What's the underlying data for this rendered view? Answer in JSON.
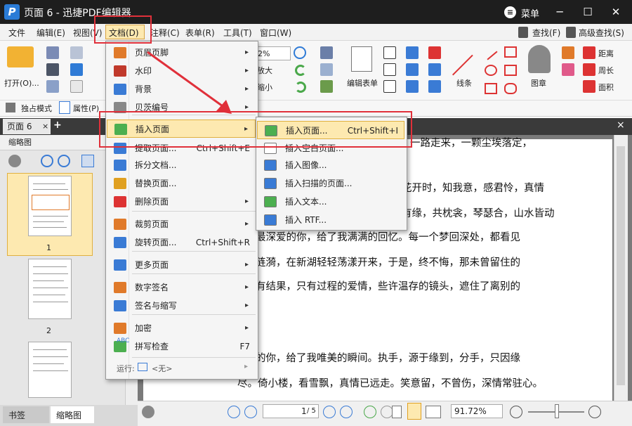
{
  "titlebar": {
    "logo": "P",
    "title": "页面 6 - 迅捷PDF编辑器",
    "menu_label": "菜单",
    "menu_icon": "≡",
    "minimize": "─",
    "maximize": "☐",
    "close": "✕"
  },
  "menubar": {
    "items": [
      "文件",
      "编辑(E)",
      "视图(V)",
      "文档(D)",
      "注释(C)",
      "表单(R)",
      "工具(T)",
      "窗口(W)"
    ],
    "find": "查找(F)",
    "advanced_find": "高级查找(S)"
  },
  "toolbar": {
    "open_label": "打开(O)...",
    "zoom_value": "2%",
    "zoom_in": "放大",
    "zoom_out": "缩小",
    "edit_form": "编辑表单",
    "line": "线条",
    "stamp": "图章",
    "distance": "距离",
    "perimeter": "周长",
    "area": "面积",
    "exclusive_mode": "独占模式",
    "properties": "属性(P)"
  },
  "tabs": {
    "doc_tab": "页面 6",
    "doc_tab_close": "×",
    "add": "+",
    "close_all": "×"
  },
  "left_panel": {
    "title": "缩略图",
    "close": "×",
    "page_numbers": [
      "1",
      "2"
    ],
    "bottom_tabs": [
      "书签",
      "缩略图"
    ]
  },
  "doc_menu": {
    "items": [
      {
        "label": "页眉页脚",
        "shortcut": "",
        "arrow": "▸",
        "color": "#e07a2a"
      },
      {
        "label": "水印",
        "shortcut": "",
        "arrow": "▸",
        "color": "#c0392b"
      },
      {
        "label": "背景",
        "shortcut": "",
        "arrow": "▸",
        "color": "#3a7bd5"
      },
      {
        "label": "贝茨编号",
        "shortcut": "",
        "arrow": "▸",
        "color": "#888888"
      },
      {
        "label": "插入页面",
        "shortcut": "",
        "arrow": "▸",
        "color": "#4caf50"
      },
      {
        "label": "提取页面...",
        "shortcut": "Ctrl+Shift+E",
        "arrow": "",
        "color": "#3a7bd5"
      },
      {
        "label": "拆分文档...",
        "shortcut": "",
        "arrow": "",
        "color": "#3a7bd5"
      },
      {
        "label": "替换页面...",
        "shortcut": "",
        "arrow": "",
        "color": "#e0a020"
      },
      {
        "label": "删除页面",
        "shortcut": "",
        "arrow": "▸",
        "color": "#d33"
      },
      {
        "label": "裁剪页面",
        "shortcut": "",
        "arrow": "▸",
        "color": "#e07a2a"
      },
      {
        "label": "旋转页面...",
        "shortcut": "Ctrl+Shift+R",
        "arrow": "",
        "color": "#3a7bd5"
      },
      {
        "label": "更多页面",
        "shortcut": "",
        "arrow": "▸",
        "color": "#3a7bd5"
      },
      {
        "label": "数字签名",
        "shortcut": "",
        "arrow": "▸",
        "color": "#e07a2a"
      },
      {
        "label": "签名与缩写",
        "shortcut": "",
        "arrow": "▸",
        "color": "#3a7bd5"
      },
      {
        "label": "加密",
        "shortcut": "",
        "arrow": "▸",
        "color": "#e07a2a"
      },
      {
        "label": "拼写检查",
        "shortcut": "F7",
        "arrow": "",
        "color": "#4caf50"
      }
    ],
    "footer_label": "运行:",
    "footer_value": "<无>",
    "footer_arrow": "▸",
    "abc": "ABC"
  },
  "insert_submenu": {
    "items": [
      {
        "label": "插入页面...",
        "shortcut": "Ctrl+Shift+I"
      },
      {
        "label": "插入空白页面...",
        "shortcut": ""
      },
      {
        "label": "插入图像...",
        "shortcut": ""
      },
      {
        "label": "插入扫描的页面...",
        "shortcut": ""
      },
      {
        "label": "插入文本...",
        "shortcut": ""
      },
      {
        "label": "插入 RTF...",
        "shortcut": ""
      }
    ]
  },
  "document": {
    "lines": [
      "一路走来，一颗尘埃落定，",
      "花开时，知我意，感君怜，真情",
      "有缘，共枕衾，琴瑟合，山水皆动",
      "最深爱的你，给了我满满的回忆。每一个梦回深处，都看见",
      "涟漪，在新湖轻轻荡漾开来，于是，终不悔，那未曾留住的",
      "有结果，只有过程的爱情，些许温存的镜头，遮住了离别的",
      "的你，给了我唯美的瞬间。执手，源于缘到，分手，只因缘",
      "尽。倚小楼，看雪飘，真情已远走。笑意留，不曾伤，深情常驻心。"
    ]
  },
  "statusbar": {
    "page_value": "1",
    "page_total": "/ 5",
    "zoom_value": "91.72%"
  },
  "colors": {
    "accent_red": "#e0303a",
    "titlebar": "#1e1e1e",
    "highlight": "#fde9b0"
  }
}
